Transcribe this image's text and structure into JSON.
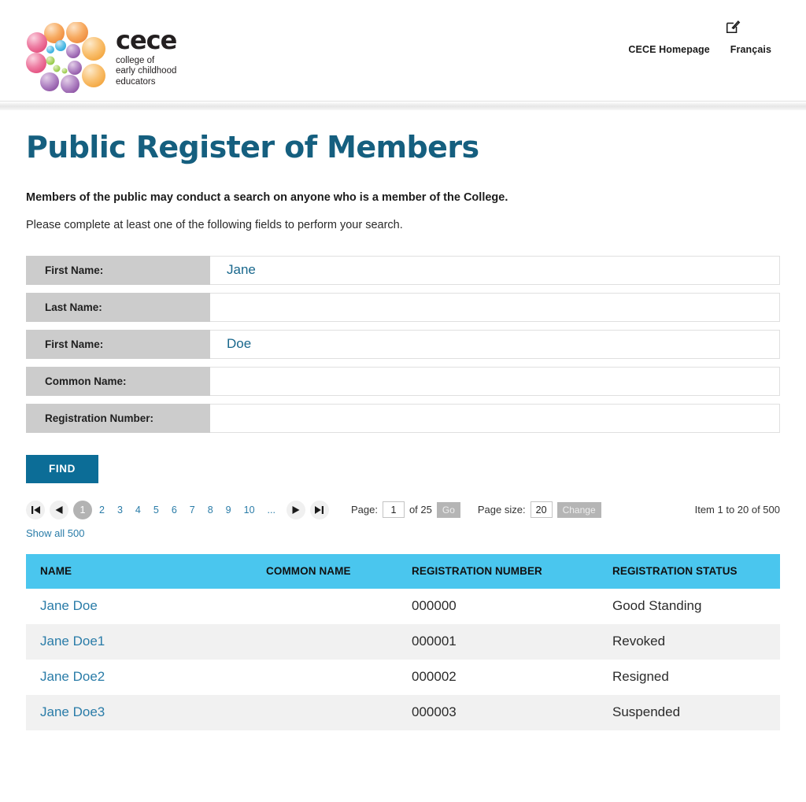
{
  "header": {
    "logo": {
      "word": "cece",
      "tagline_lines": [
        "college of",
        "early childhood",
        "educators"
      ]
    },
    "nav": {
      "homepage_label": "CECE Homepage",
      "francais_label": "Français",
      "compose_icon": "compose-square-pencil-icon"
    }
  },
  "page": {
    "title": "Public Register of Members",
    "intro_bold": "Members of the public may conduct a search on anyone who is a member of the College.",
    "intro_plain": "Please complete at least one of the following fields to perform your search."
  },
  "search_form": {
    "fields": [
      {
        "label": "First Name:",
        "value": "Jane",
        "placeholder": ""
      },
      {
        "label": "Last Name:",
        "value": "",
        "placeholder": ""
      },
      {
        "label": "First Name:",
        "value": "Doe",
        "placeholder": ""
      },
      {
        "label": "Common Name:",
        "value": "",
        "placeholder": ""
      },
      {
        "label": "Registration Number:",
        "value": "",
        "placeholder": ""
      }
    ],
    "find_label": "FIND"
  },
  "pager": {
    "first_icon": "first-page-icon",
    "prev_icon": "previous-page-icon",
    "next_icon": "next-page-icon",
    "last_icon": "last-page-icon",
    "current_page": "1",
    "page_numbers": [
      "2",
      "3",
      "4",
      "5",
      "6",
      "7",
      "8",
      "9",
      "10"
    ],
    "ellipsis": "...",
    "page_label": "Page:",
    "page_value": "1",
    "of_label": "of 25",
    "go_label": "Go",
    "page_size_label": "Page size:",
    "page_size_value": "20",
    "change_label": "Change",
    "item_count": "Item 1 to 20 of 500",
    "show_all_label": "Show all 500"
  },
  "results_table": {
    "columns": [
      "NAME",
      "COMMON NAME",
      "REGISTRATION NUMBER",
      "REGISTRATION STATUS"
    ],
    "rows": [
      {
        "name": "Jane Doe",
        "common_name": "",
        "registration_number": "000000",
        "registration_status": "Good Standing"
      },
      {
        "name": "Jane Doe1",
        "common_name": "",
        "registration_number": "000001",
        "registration_status": "Revoked"
      },
      {
        "name": "Jane Doe2",
        "common_name": "",
        "registration_number": "000002",
        "registration_status": "Resigned"
      },
      {
        "name": "Jane Doe3",
        "common_name": "",
        "registration_number": "000003",
        "registration_status": "Suspended"
      }
    ]
  },
  "colors": {
    "title_blue": "#155f7f",
    "button_blue": "#0c6d97",
    "link_blue": "#2a7ca8",
    "table_header_cyan": "#4ac6ee",
    "label_gray": "#cccccc"
  }
}
